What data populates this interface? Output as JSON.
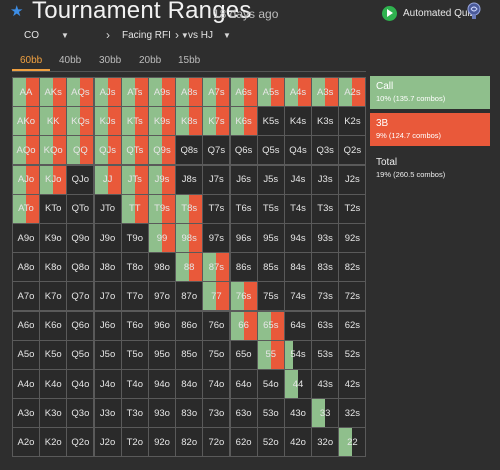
{
  "header": {
    "title": "Tournament Ranges",
    "subtitle": "18 days ago",
    "quiz_label": "Automated Quiz"
  },
  "filters": {
    "position": "CO",
    "action": "Facing RFI",
    "versus": "vs HJ"
  },
  "tabs": [
    {
      "label": "60bb",
      "active": true
    },
    {
      "label": "40bb",
      "active": false
    },
    {
      "label": "30bb",
      "active": false
    },
    {
      "label": "20bb",
      "active": false
    },
    {
      "label": "15bb",
      "active": false
    }
  ],
  "legend": {
    "call": {
      "label": "Call",
      "detail": "10% (135.7 combos)"
    },
    "threebet": {
      "label": "3B",
      "detail": "9% (124.7 combos)"
    },
    "total": {
      "label": "Total",
      "detail": "19% (260.5 combos)"
    }
  },
  "colors": {
    "call": "#8fbf8c",
    "threebet": "#e9593a",
    "fold": "#2a2a2a",
    "accent_tab": "#f0a040",
    "play_button": "#2fb24f"
  },
  "grid": {
    "ranks": [
      "A",
      "K",
      "Q",
      "J",
      "T",
      "9",
      "8",
      "7",
      "6",
      "5",
      "4",
      "3",
      "2"
    ],
    "hands": [
      [
        "AA",
        "AKs",
        "AQs",
        "AJs",
        "ATs",
        "A9s",
        "A8s",
        "A7s",
        "A6s",
        "A5s",
        "A4s",
        "A3s",
        "A2s"
      ],
      [
        "AKo",
        "KK",
        "KQs",
        "KJs",
        "KTs",
        "K9s",
        "K8s",
        "K7s",
        "K6s",
        "K5s",
        "K4s",
        "K3s",
        "K2s"
      ],
      [
        "AQo",
        "KQo",
        "QQ",
        "QJs",
        "QTs",
        "Q9s",
        "Q8s",
        "Q7s",
        "Q6s",
        "Q5s",
        "Q4s",
        "Q3s",
        "Q2s"
      ],
      [
        "AJo",
        "KJo",
        "QJo",
        "JJ",
        "JTs",
        "J9s",
        "J8s",
        "J7s",
        "J6s",
        "J5s",
        "J4s",
        "J3s",
        "J2s"
      ],
      [
        "ATo",
        "KTo",
        "QTo",
        "JTo",
        "TT",
        "T9s",
        "T8s",
        "T7s",
        "T6s",
        "T5s",
        "T4s",
        "T3s",
        "T2s"
      ],
      [
        "A9o",
        "K9o",
        "Q9o",
        "J9o",
        "T9o",
        "99",
        "98s",
        "97s",
        "96s",
        "95s",
        "94s",
        "93s",
        "92s"
      ],
      [
        "A8o",
        "K8o",
        "Q8o",
        "J8o",
        "T8o",
        "98o",
        "88",
        "87s",
        "86s",
        "85s",
        "84s",
        "83s",
        "82s"
      ],
      [
        "A7o",
        "K7o",
        "Q7o",
        "J7o",
        "T7o",
        "97o",
        "87o",
        "77",
        "76s",
        "75s",
        "74s",
        "73s",
        "72s"
      ],
      [
        "A6o",
        "K6o",
        "Q6o",
        "J6o",
        "T6o",
        "96o",
        "86o",
        "76o",
        "66",
        "65s",
        "64s",
        "63s",
        "62s"
      ],
      [
        "A5o",
        "K5o",
        "Q5o",
        "J5o",
        "T5o",
        "95o",
        "85o",
        "75o",
        "65o",
        "55",
        "54s",
        "53s",
        "52s"
      ],
      [
        "A4o",
        "K4o",
        "Q4o",
        "J4o",
        "T4o",
        "94o",
        "84o",
        "74o",
        "64o",
        "54o",
        "44",
        "43s",
        "42s"
      ],
      [
        "A3o",
        "K3o",
        "Q3o",
        "J3o",
        "T3o",
        "93o",
        "83o",
        "73o",
        "63o",
        "53o",
        "43o",
        "33",
        "32s"
      ],
      [
        "A2o",
        "K2o",
        "Q2o",
        "J2o",
        "T2o",
        "92o",
        "82o",
        "72o",
        "62o",
        "52o",
        "42o",
        "32o",
        "22"
      ]
    ],
    "mix_note": "each value is [call_fraction, threebet_fraction] of the combos",
    "mix": {
      "AA": [
        0.5,
        0.5
      ],
      "AKs": [
        0.5,
        0.5
      ],
      "AQs": [
        0.5,
        0.5
      ],
      "AJs": [
        0.5,
        0.5
      ],
      "ATs": [
        0.5,
        0.5
      ],
      "A9s": [
        0.5,
        0.5
      ],
      "A8s": [
        0.5,
        0.5
      ],
      "A7s": [
        0.5,
        0.5
      ],
      "A6s": [
        0.5,
        0.5
      ],
      "A5s": [
        0.5,
        0.5
      ],
      "A4s": [
        0.5,
        0.5
      ],
      "A3s": [
        0.5,
        0.5
      ],
      "A2s": [
        0.5,
        0.5
      ],
      "AKo": [
        0.5,
        0.5
      ],
      "KK": [
        0.5,
        0.5
      ],
      "KQs": [
        0.5,
        0.5
      ],
      "KJs": [
        0.5,
        0.5
      ],
      "KTs": [
        0.5,
        0.5
      ],
      "K9s": [
        0.5,
        0.5
      ],
      "K8s": [
        0.5,
        0.5
      ],
      "K7s": [
        0.5,
        0.5
      ],
      "K6s": [
        0.5,
        0.5
      ],
      "AQo": [
        0.5,
        0.5
      ],
      "KQo": [
        0.5,
        0.5
      ],
      "QQ": [
        0.5,
        0.5
      ],
      "QJs": [
        0.5,
        0.5
      ],
      "QTs": [
        0.5,
        0.5
      ],
      "Q9s": [
        0.5,
        0.5
      ],
      "AJo": [
        0.5,
        0.5
      ],
      "KJo": [
        0.5,
        0.5
      ],
      "JJ": [
        0.5,
        0.5
      ],
      "JTs": [
        0.5,
        0.5
      ],
      "J9s": [
        0.5,
        0.5
      ],
      "ATo": [
        0.5,
        0.5
      ],
      "TT": [
        0.5,
        0.5
      ],
      "T9s": [
        0.5,
        0.5
      ],
      "T8s": [
        0.5,
        0.5
      ],
      "99": [
        0.5,
        0.5
      ],
      "98s": [
        0.5,
        0.5
      ],
      "88": [
        0.5,
        0.5
      ],
      "87s": [
        0.5,
        0.5
      ],
      "77": [
        0.5,
        0.5
      ],
      "76s": [
        0.5,
        0.5
      ],
      "66": [
        0.5,
        0.5
      ],
      "65s": [
        0.5,
        0.5
      ],
      "55": [
        0.5,
        0.5
      ],
      "54s": [
        0.3,
        0.0
      ],
      "44": [
        0.5,
        0.0
      ],
      "33": [
        0.5,
        0.0
      ],
      "22": [
        0.5,
        0.0
      ]
    }
  }
}
